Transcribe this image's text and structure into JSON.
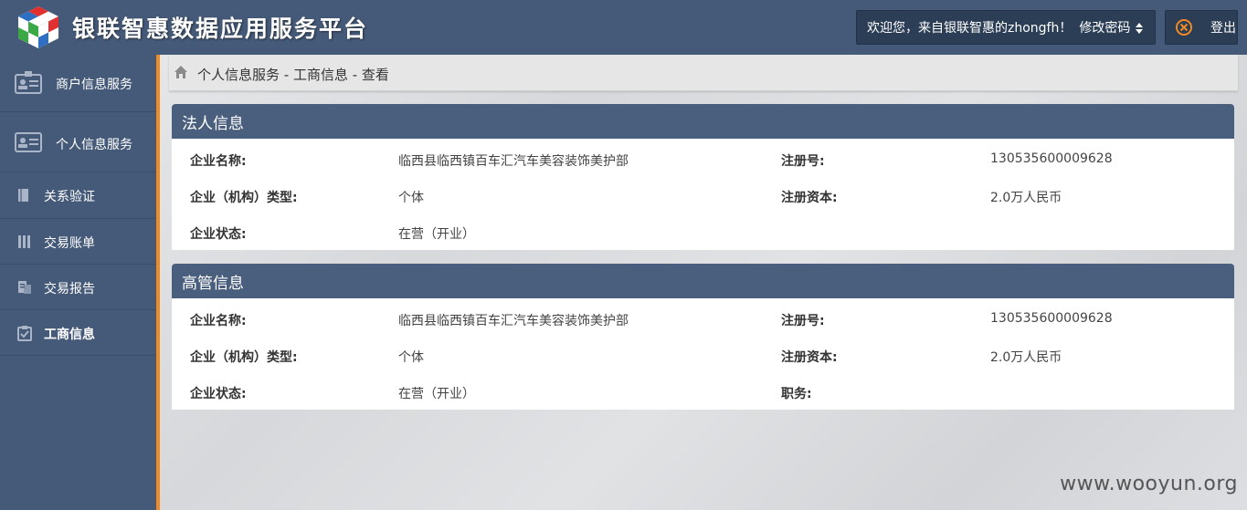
{
  "header": {
    "app_title": "银联智惠数据应用服务平台",
    "welcome_text": "欢迎您，来自银联智惠的zhongfh！",
    "change_password_label": "修改密码",
    "logout_label": "登出"
  },
  "sidebar": {
    "items": [
      {
        "label": "商户信息服务",
        "icon": "merchant-card-icon"
      },
      {
        "label": "个人信息服务",
        "icon": "id-card-icon"
      },
      {
        "label": "关系验证",
        "icon": "bookmark-icon"
      },
      {
        "label": "交易账单",
        "icon": "columns-icon"
      },
      {
        "label": "交易报告",
        "icon": "report-icon"
      },
      {
        "label": "工商信息",
        "icon": "clipboard-icon",
        "active": true
      }
    ]
  },
  "breadcrumb": "个人信息服务 - 工商信息 - 查看",
  "panels": [
    {
      "title": "法人信息",
      "fields": {
        "company_name": {
          "label": "企业名称:",
          "value": "临西县临西镇百车汇汽车美容装饰美护部"
        },
        "reg_no": {
          "label": "注册号:",
          "value": "130535600009628"
        },
        "org_type": {
          "label": "企业（机构）类型:",
          "value": "个体"
        },
        "capital": {
          "label": "注册资本:",
          "value": "2.0万人民币"
        },
        "status": {
          "label": "企业状态:",
          "value": "在营（开业）"
        }
      }
    },
    {
      "title": "高管信息",
      "fields": {
        "company_name": {
          "label": "企业名称:",
          "value": "临西县临西镇百车汇汽车美容装饰美护部"
        },
        "reg_no": {
          "label": "注册号:",
          "value": "130535600009628"
        },
        "org_type": {
          "label": "企业（机构）类型:",
          "value": "个体"
        },
        "capital": {
          "label": "注册资本:",
          "value": "2.0万人民币"
        },
        "status": {
          "label": "企业状态:",
          "value": "在营（开业）"
        },
        "position": {
          "label": "职务:",
          "value": ""
        }
      }
    }
  ],
  "watermark": "www.wooyun.org",
  "colors": {
    "header_bg": "#455a78",
    "panel_head_bg": "#4a5f7e",
    "accent": "#f08a24"
  }
}
